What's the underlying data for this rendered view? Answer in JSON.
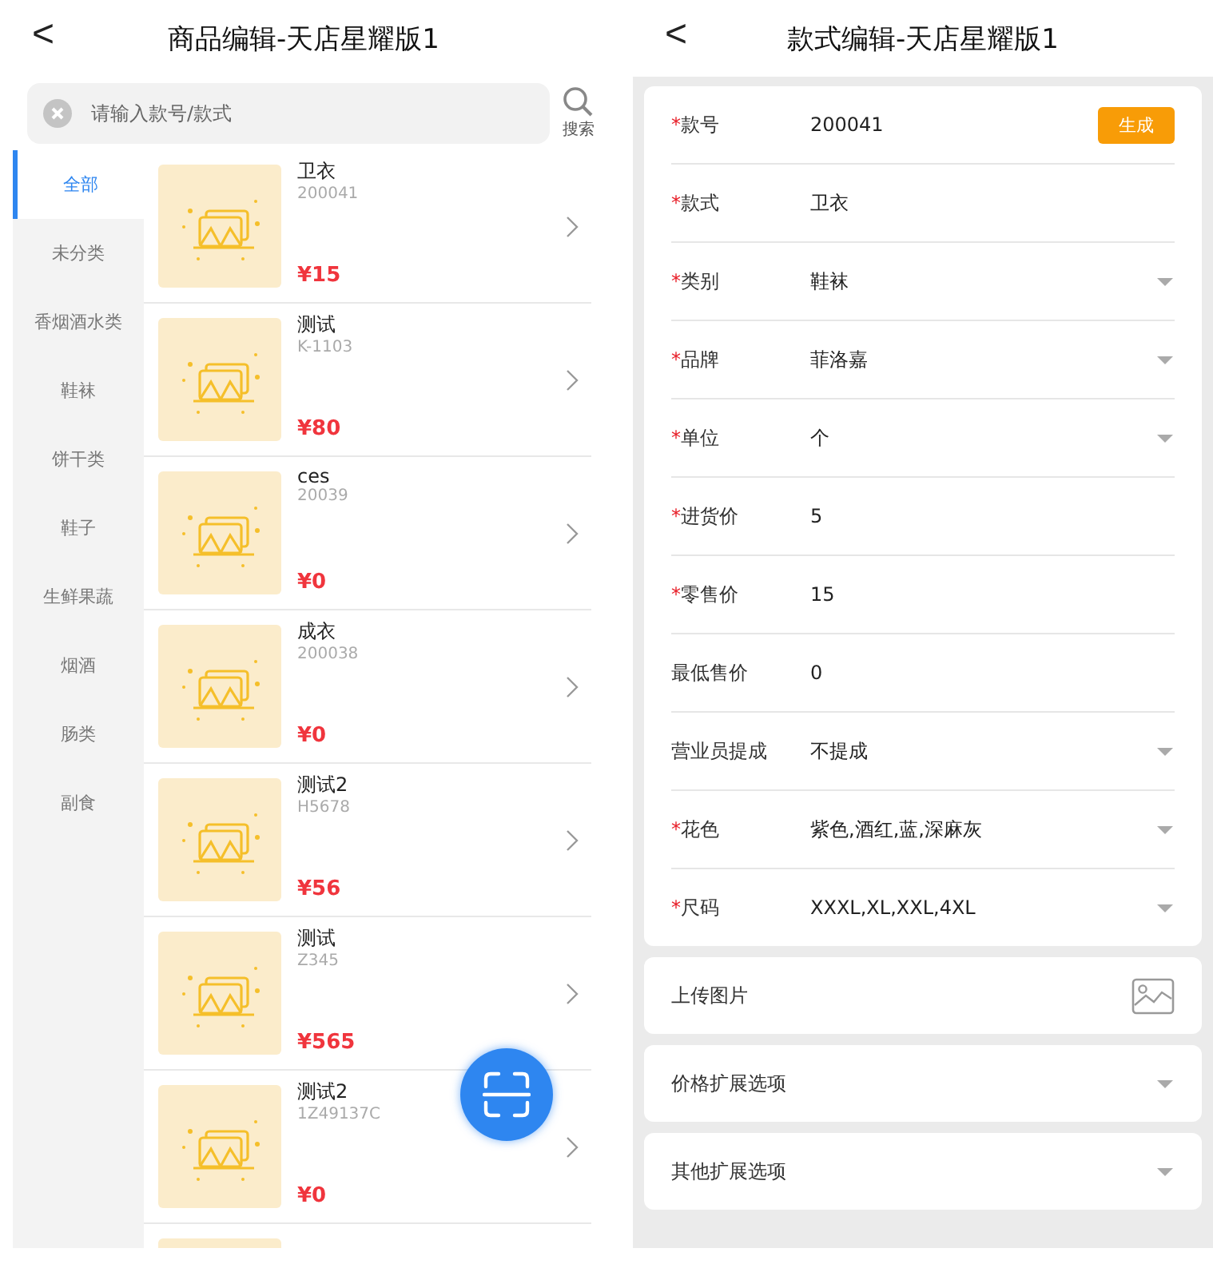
{
  "left_screen": {
    "title": "商品编辑-天店星耀版1",
    "back": "<",
    "search": {
      "placeholder": "请输入款号/款式",
      "button": "搜索"
    },
    "categories": [
      {
        "label": "全部",
        "selected": true
      },
      {
        "label": "未分类",
        "selected": false
      },
      {
        "label": "香烟酒水类",
        "selected": false
      },
      {
        "label": "鞋袜",
        "selected": false
      },
      {
        "label": "饼干类",
        "selected": false
      },
      {
        "label": "鞋子",
        "selected": false
      },
      {
        "label": "生鲜果蔬",
        "selected": false
      },
      {
        "label": "烟酒",
        "selected": false
      },
      {
        "label": "肠类",
        "selected": false
      },
      {
        "label": "副食",
        "selected": false
      }
    ],
    "products": [
      {
        "name": "卫衣",
        "code": "200041",
        "price": "¥15"
      },
      {
        "name": "测试",
        "code": "K-1103",
        "price": "¥80"
      },
      {
        "name": "ces",
        "code": "20039",
        "price": "¥0"
      },
      {
        "name": "成衣",
        "code": "200038",
        "price": "¥0"
      },
      {
        "name": "测试2",
        "code": "H5678",
        "price": "¥56"
      },
      {
        "name": "测试",
        "code": "Z345",
        "price": "¥565"
      },
      {
        "name": "测试2",
        "code": "1Z49137C",
        "price": "¥0"
      }
    ]
  },
  "right_screen": {
    "title": "款式编辑-天店星耀版1",
    "back": "<",
    "fields": [
      {
        "required_mark": "*",
        "label": "款号",
        "value": "200041",
        "kind": "generate",
        "button": "生成"
      },
      {
        "required_mark": "*",
        "label": "款式",
        "value": "卫衣",
        "kind": "text"
      },
      {
        "required_mark": "*",
        "label": "类别",
        "value": "鞋袜",
        "kind": "select"
      },
      {
        "required_mark": "*",
        "label": "品牌",
        "value": "菲洛嘉",
        "kind": "select"
      },
      {
        "required_mark": "*",
        "label": "单位",
        "value": "个",
        "kind": "select"
      },
      {
        "required_mark": "*",
        "label": "进货价",
        "value": "5",
        "kind": "text"
      },
      {
        "required_mark": "*",
        "label": "零售价",
        "value": "15",
        "kind": "text"
      },
      {
        "label": "最低售价",
        "value": "0",
        "kind": "text"
      },
      {
        "label": "营业员提成",
        "value": "不提成",
        "kind": "select"
      },
      {
        "required_mark": "*",
        "label": "花色",
        "value": "紫色,酒红,蓝,深麻灰",
        "kind": "select"
      },
      {
        "required_mark": "*",
        "label": "尺码",
        "value": "XXXL,XL,XXL,4XL",
        "kind": "select"
      }
    ],
    "sections": [
      {
        "label": "上传图片",
        "kind": "image"
      },
      {
        "label": "价格扩展选项",
        "kind": "select"
      },
      {
        "label": "其他扩展选项",
        "kind": "select"
      }
    ]
  }
}
